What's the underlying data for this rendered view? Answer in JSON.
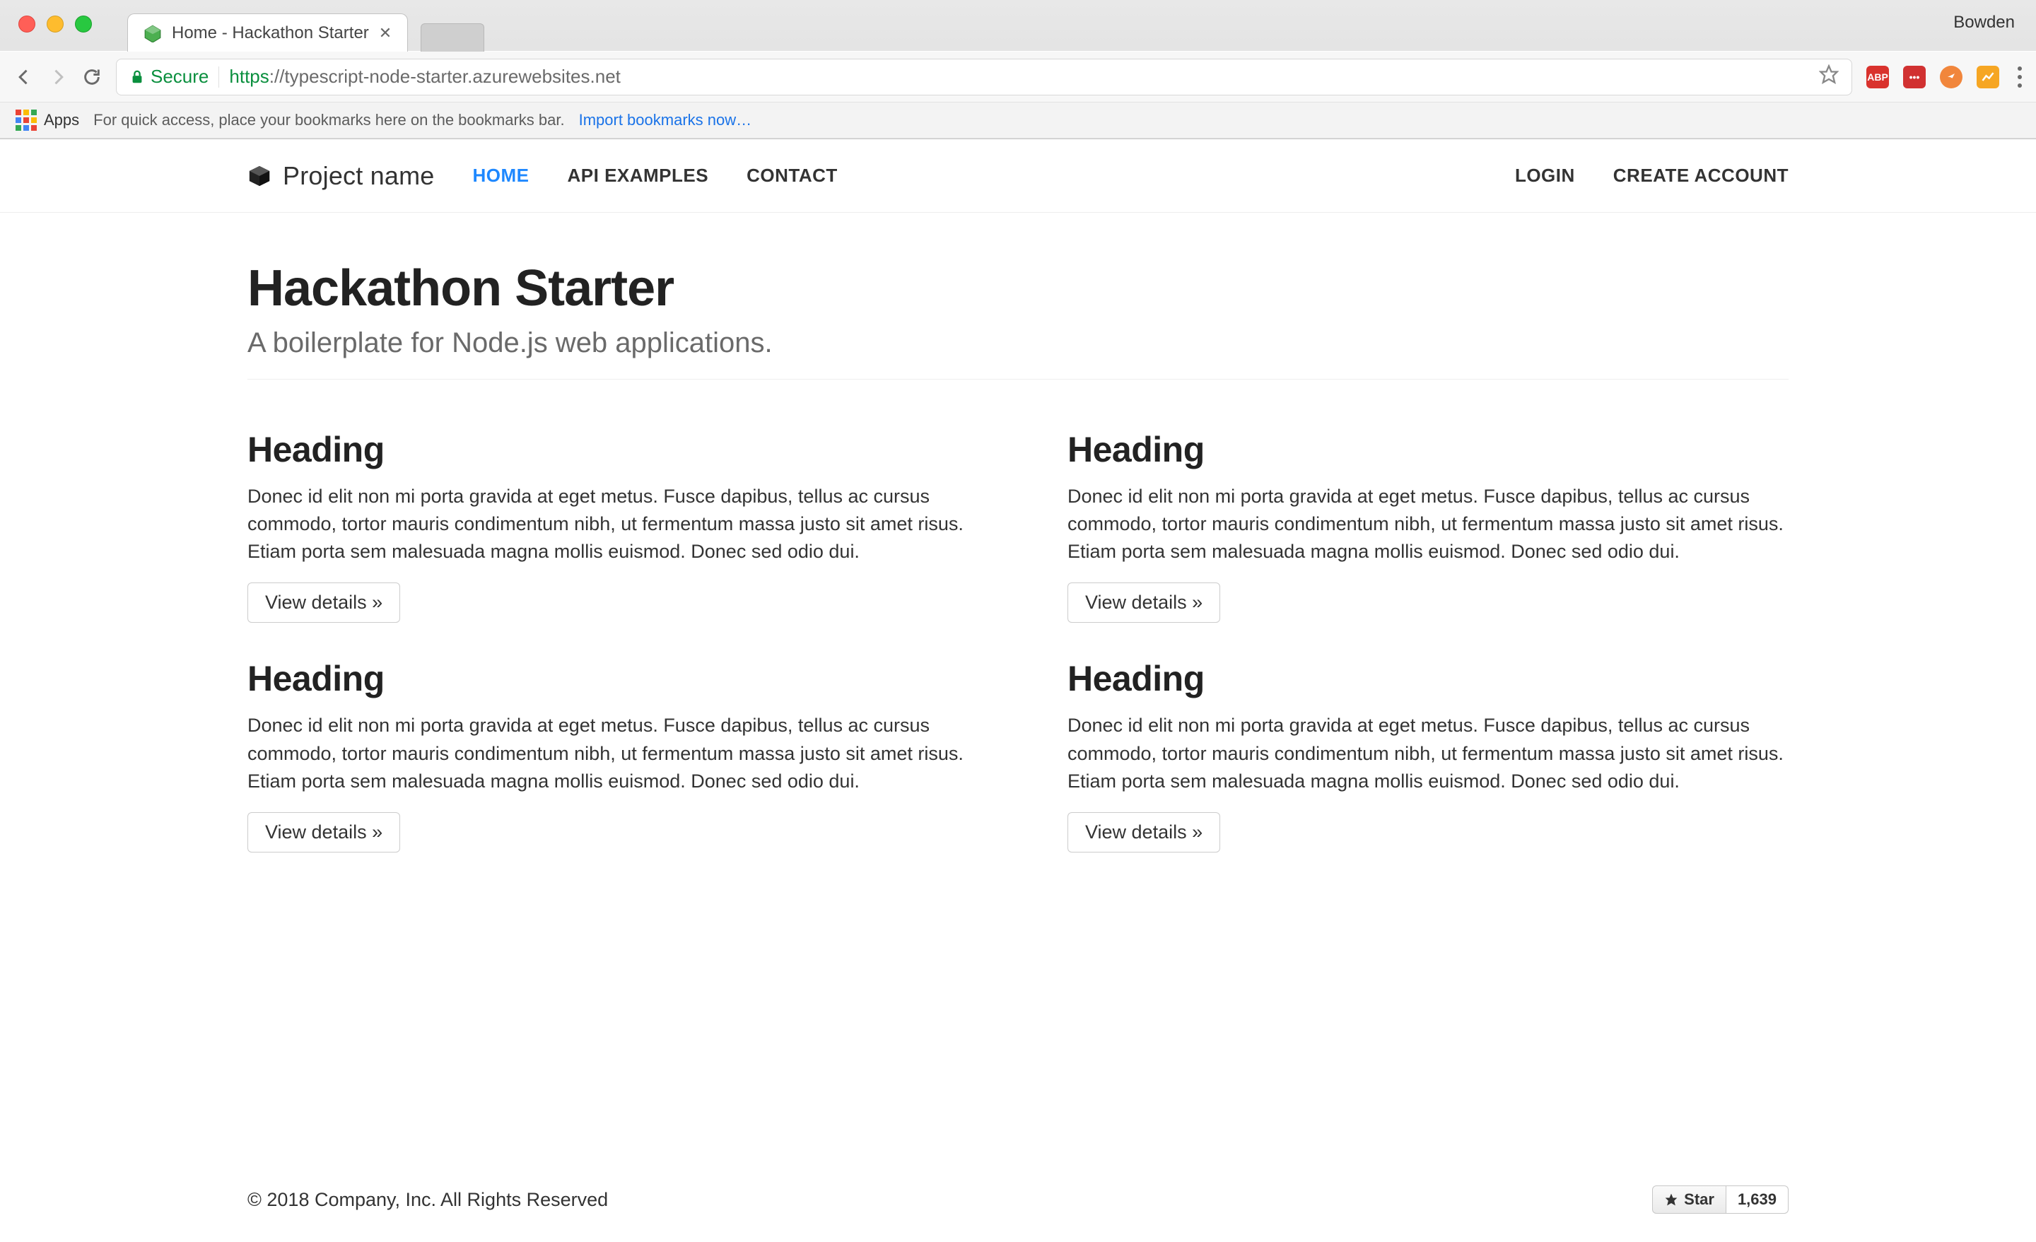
{
  "browser": {
    "profile_name": "Bowden",
    "tab_title": "Home - Hackathon Starter",
    "secure_label": "Secure",
    "url_protocol": "https",
    "url_host": "://typescript-node-starter.azurewebsites.net",
    "bookmarks_apps_label": "Apps",
    "bookmarks_hint": "For quick access, place your bookmarks here on the bookmarks bar.",
    "bookmarks_import": "Import bookmarks now…",
    "extensions": {
      "abp": "ABP",
      "lp": "•••"
    }
  },
  "nav": {
    "brand": "Project name",
    "links": [
      "HOME",
      "API EXAMPLES",
      "CONTACT"
    ],
    "right": [
      "LOGIN",
      "CREATE ACCOUNT"
    ]
  },
  "hero": {
    "title": "Hackathon Starter",
    "subtitle": "A boilerplate for Node.js web applications."
  },
  "cards": [
    {
      "heading": "Heading",
      "body": "Donec id elit non mi porta gravida at eget metus. Fusce dapibus, tellus ac cursus commodo, tortor mauris condimentum nibh, ut fermentum massa justo sit amet risus. Etiam porta sem malesuada magna mollis euismod. Donec sed odio dui.",
      "button": "View details »"
    },
    {
      "heading": "Heading",
      "body": "Donec id elit non mi porta gravida at eget metus. Fusce dapibus, tellus ac cursus commodo, tortor mauris condimentum nibh, ut fermentum massa justo sit amet risus. Etiam porta sem malesuada magna mollis euismod. Donec sed odio dui.",
      "button": "View details »"
    },
    {
      "heading": "Heading",
      "body": "Donec id elit non mi porta gravida at eget metus. Fusce dapibus, tellus ac cursus commodo, tortor mauris condimentum nibh, ut fermentum massa justo sit amet risus. Etiam porta sem malesuada magna mollis euismod. Donec sed odio dui.",
      "button": "View details »"
    },
    {
      "heading": "Heading",
      "body": "Donec id elit non mi porta gravida at eget metus. Fusce dapibus, tellus ac cursus commodo, tortor mauris condimentum nibh, ut fermentum massa justo sit amet risus. Etiam porta sem malesuada magna mollis euismod. Donec sed odio dui.",
      "button": "View details »"
    }
  ],
  "footer": {
    "copyright": "© 2018 Company, Inc. All Rights Reserved",
    "star_label": "Star",
    "star_count": "1,639"
  }
}
